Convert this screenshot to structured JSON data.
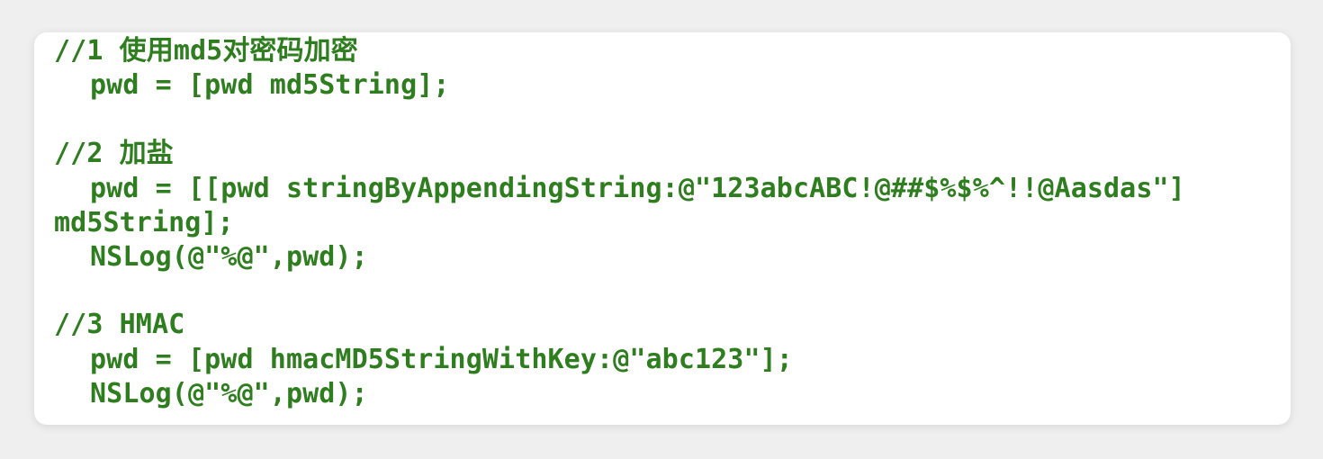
{
  "code": {
    "lines": [
      "//1 使用md5对密码加密",
      "pwd = [pwd md5String];",
      "//2 加盐",
      "pwd = [[pwd stringByAppendingString:@\"123abcABC!@##$%$%^!!@Aasdas\"]",
      "md5String];",
      "NSLog(@\"%@\",pwd);",
      "//3 HMAC",
      "pwd = [pwd hmacMD5StringWithKey:@\"abc123\"];",
      "NSLog(@\"%@\",pwd);"
    ]
  },
  "colors": {
    "code_text": "#2e7d1e",
    "card_background": "#ffffff",
    "page_background": "#efefef"
  }
}
